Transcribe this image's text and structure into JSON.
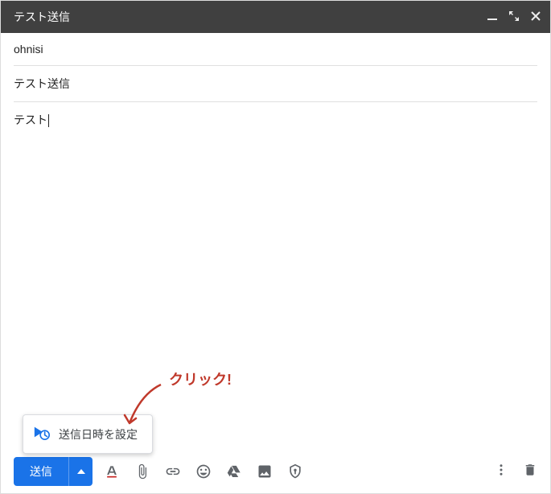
{
  "header": {
    "title": "テスト送信"
  },
  "fields": {
    "to": "ohnisi",
    "subject": "テスト送信"
  },
  "body": {
    "text": "テスト"
  },
  "annotation": {
    "label": "クリック!"
  },
  "popup": {
    "schedule_label": "送信日時を設定"
  },
  "toolbar": {
    "send_label": "送信"
  }
}
